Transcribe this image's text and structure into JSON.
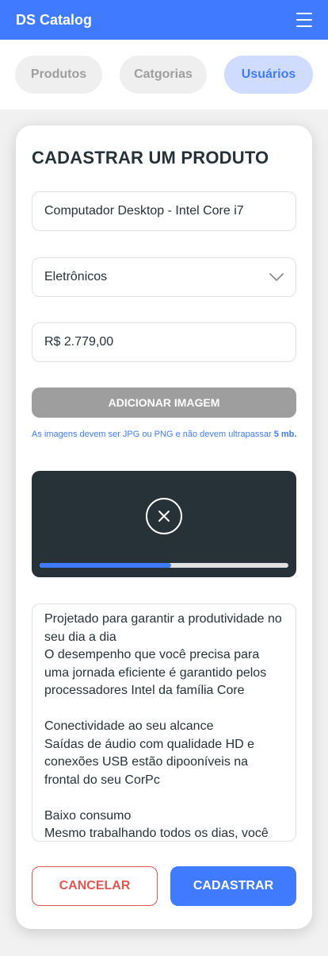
{
  "navbar": {
    "brand": "DS Catalog",
    "menu_icon": "hamburger-menu-icon"
  },
  "tabs": [
    {
      "label": "Produtos",
      "active": false
    },
    {
      "label": "Catgorias",
      "active": false
    },
    {
      "label": "Usuários",
      "active": true
    }
  ],
  "form": {
    "title": "CADASTRAR UM PRODUTO",
    "name_value": "Computador Desktop - Intel Core i7",
    "category_value": "Eletrônicos",
    "category_icon": "chevron-down-icon",
    "price_value": "R$ 2.779,00",
    "add_image_label": "ADICIONAR IMAGEM",
    "image_hint_text": "As imagens devem ser  JPG ou PNG e não devem ultrapassar ",
    "image_hint_size": "5 mb.",
    "upload": {
      "cancel_icon": "close-circle-icon",
      "progress": 0.53
    },
    "description": "Projetado para garantir a produtividade no seu dia a dia\nO desempenho que você precisa para uma jornada eficiente é garantido pelos processadores Intel da família Core\n\nConectividade ao seu alcance\nSaídas de áudio com qualidade HD e conexões USB estão dipooníveis na frontal do seu CorPc\n\nBaixo consumo\nMesmo trabalhando todos os dias, você",
    "cancel_label": "CANCELAR",
    "submit_label": "CADASTRAR"
  },
  "colors": {
    "primary": "#407bff",
    "danger": "#df5753",
    "dark": "#263238",
    "gray": "#9e9e9e"
  }
}
